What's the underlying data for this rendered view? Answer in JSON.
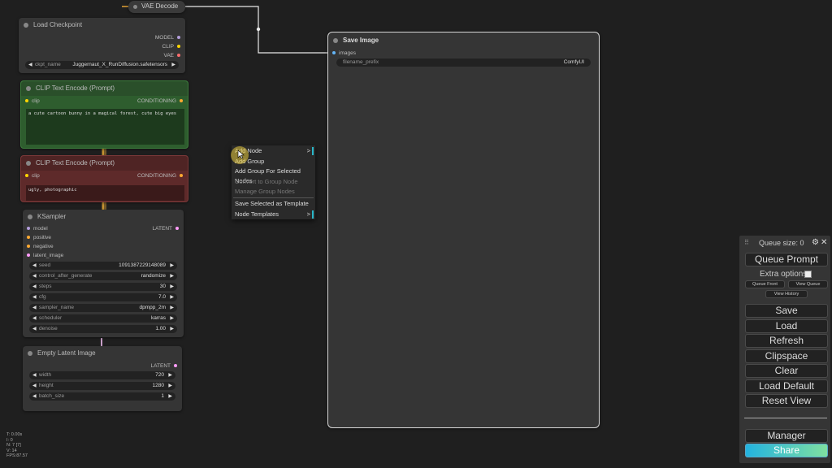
{
  "nodes": {
    "vae_decode": {
      "title": "VAE Decode"
    },
    "load_checkpoint": {
      "title": "Load Checkpoint",
      "outputs": [
        "MODEL",
        "CLIP",
        "VAE"
      ],
      "widget": {
        "name": "ckpt_name",
        "value": "Juggernaut_X_RunDiffusion.safetensors"
      }
    },
    "clip_positive": {
      "title": "CLIP Text Encode (Prompt)",
      "input": "clip",
      "output": "CONDITIONING",
      "text": "a cute cartoon bunny in a magical forest, cute big eyes"
    },
    "clip_negative": {
      "title": "CLIP Text Encode (Prompt)",
      "input": "clip",
      "output": "CONDITIONING",
      "text": "ugly, photographic"
    },
    "ksampler": {
      "title": "KSampler",
      "inputs": [
        "model",
        "positive",
        "negative",
        "latent_image"
      ],
      "output": "LATENT",
      "widgets": [
        {
          "name": "seed",
          "value": "1091387229148089"
        },
        {
          "name": "control_after_generate",
          "value": "randomize"
        },
        {
          "name": "steps",
          "value": "30"
        },
        {
          "name": "cfg",
          "value": "7.0"
        },
        {
          "name": "sampler_name",
          "value": "dpmpp_2m"
        },
        {
          "name": "scheduler",
          "value": "karras"
        },
        {
          "name": "denoise",
          "value": "1.00"
        }
      ]
    },
    "empty_latent": {
      "title": "Empty Latent Image",
      "output": "LATENT",
      "widgets": [
        {
          "name": "width",
          "value": "720"
        },
        {
          "name": "height",
          "value": "1280"
        },
        {
          "name": "batch_size",
          "value": "1"
        }
      ]
    },
    "save_image": {
      "title": "Save Image",
      "input": "images",
      "widget": {
        "name": "filename_prefix",
        "value": "ComfyUI"
      }
    }
  },
  "context_menu": {
    "items": [
      {
        "label": "Add Node",
        "submenu": true
      },
      {
        "label": "Add Group"
      },
      {
        "label": "Add Group For Selected Nodes"
      },
      {
        "label": "Convert to Group Node",
        "disabled": true
      },
      {
        "label": "Manage Group Nodes",
        "disabled": true
      },
      {
        "label": "Save Selected as Template"
      },
      {
        "label": "Node Templates",
        "submenu": true
      }
    ]
  },
  "panel": {
    "queue_size": "Queue size: 0",
    "queue_prompt": "Queue Prompt",
    "extra_options": "Extra options",
    "queue_front": "Queue Front",
    "view_queue": "View Queue",
    "view_history": "View History",
    "buttons": [
      "Save",
      "Load",
      "Refresh",
      "Clipspace",
      "Clear",
      "Load Default",
      "Reset View"
    ],
    "manager": "Manager",
    "share": "Share"
  },
  "stats": {
    "t": "T: 0.00s",
    "i": "I: 0",
    "n": "N: 7 [7]",
    "v": "V: 14",
    "fps": "FPS:87.57"
  },
  "colors": {
    "clip_pin": "#ffd500",
    "conditioning_pin": "#ffa931",
    "latent_pin": "#ff9cf9",
    "images_pin": "#64b5f6",
    "positive_node": "#2e5d2e",
    "negative_node": "#5e2a2a",
    "share_button": "#2ab7c9"
  }
}
